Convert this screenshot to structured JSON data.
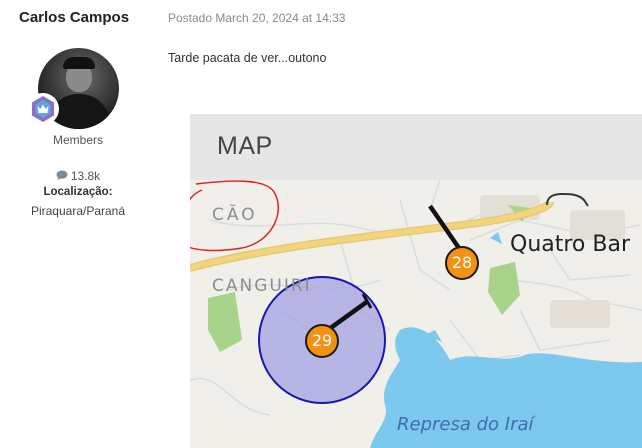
{
  "author": {
    "name": "Carlos Campos",
    "group": "Members",
    "posts_count": "13.8k",
    "location_label": "Localização:",
    "location_value": "Piraquara/Paraná",
    "avatar_icon": "user-avatar",
    "rank_icon": "crown-badge-icon"
  },
  "post": {
    "meta": "Postado March 20, 2024 at 14:33",
    "text": "Tarde pacata de ver...outono"
  },
  "map": {
    "title": "MAP",
    "place_labels": {
      "cao": "CÃO",
      "canguiri": "CANGUIRI",
      "quatro": "Quatro Bar",
      "represa": "Represa do Iraí"
    },
    "markers": [
      {
        "label": "28",
        "color": "#f39112"
      },
      {
        "label": "29",
        "color": "#f39112"
      }
    ],
    "colors": {
      "water": "#7cc8ee",
      "green": "#a8d38b",
      "highway": "#f2d47a",
      "annotation": "#e01b1b",
      "circle_fill": "#a3a1e0",
      "circle_stroke": "#1616b0"
    }
  }
}
